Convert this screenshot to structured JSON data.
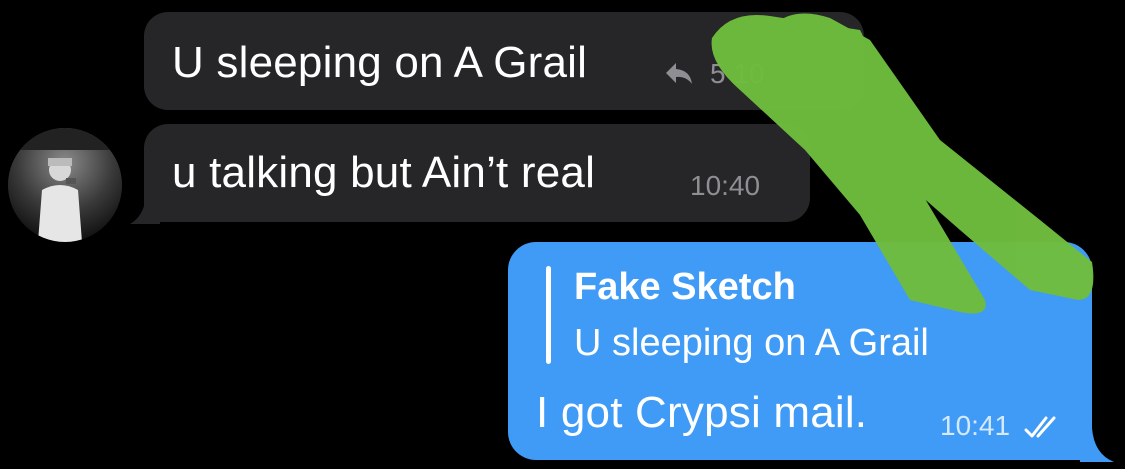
{
  "messages": [
    {
      "text": "U sleeping on A Grail",
      "time": "5 10"
    },
    {
      "text": "u talking but Ain’t real",
      "time": "10:40"
    },
    {
      "reply_to": {
        "name": "Fake Sketch",
        "text": "U sleeping on A Grail"
      },
      "text": "I got Crypsi mail.",
      "time": "10:41"
    }
  ],
  "colors": {
    "incoming_bubble": "#262628",
    "outgoing_bubble": "#3f9bf5",
    "redaction": "#6fbd3e"
  },
  "icons": [
    "reply-arrow-icon",
    "double-check-icon"
  ]
}
